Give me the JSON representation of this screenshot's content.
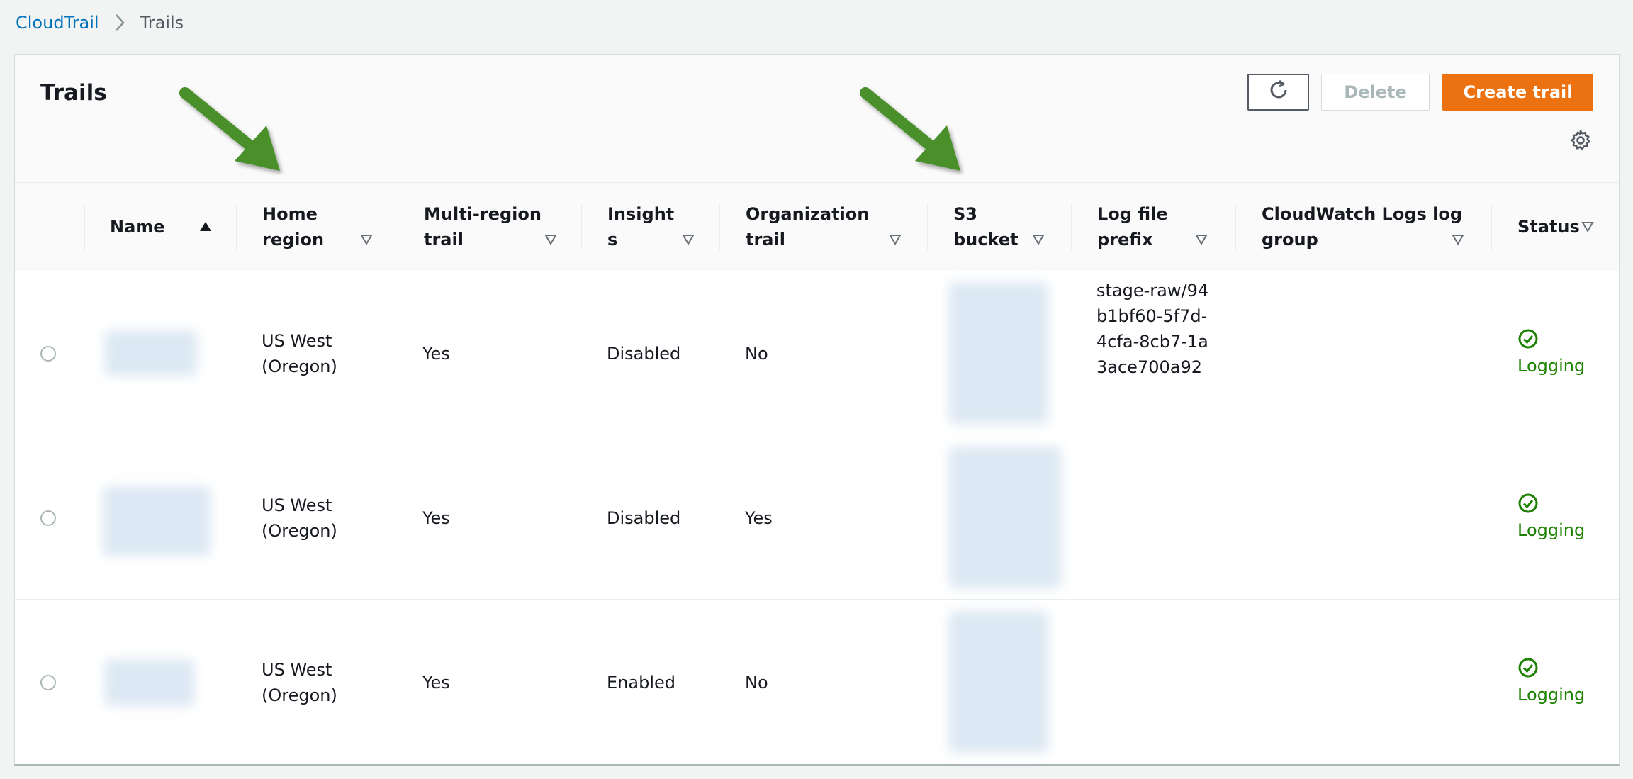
{
  "breadcrumb": {
    "root": "CloudTrail",
    "current": "Trails"
  },
  "header": {
    "title": "Trails",
    "refresh_icon": "refresh-icon",
    "delete_label": "Delete",
    "create_label": "Create trail",
    "settings_icon": "gear-icon"
  },
  "table": {
    "columns": [
      {
        "label": "Name",
        "sort": "ascending"
      },
      {
        "label": "Home\nregion",
        "sort": "none"
      },
      {
        "label": "Multi-region\ntrail",
        "sort": "none"
      },
      {
        "label": "Insight\ns",
        "sort": "none"
      },
      {
        "label": "Organization\ntrail",
        "sort": "none"
      },
      {
        "label": "S3\nbucket",
        "sort": "none"
      },
      {
        "label": "Log file\nprefix",
        "sort": "none"
      },
      {
        "label": "CloudWatch Logs log\ngroup",
        "sort": "none"
      },
      {
        "label": "Status",
        "sort": "none"
      }
    ],
    "rows": [
      {
        "home_region": "US West\n(Oregon)",
        "multi_region": "Yes",
        "insights": "Disabled",
        "organization": "No",
        "log_file_prefix": "stage-raw/94b1bf60-5f7d-4cfa-8cb7-1a3ace700a92",
        "cloudwatch_group": "",
        "status": "Logging"
      },
      {
        "home_region": "US West\n(Oregon)",
        "multi_region": "Yes",
        "insights": "Disabled",
        "organization": "Yes",
        "log_file_prefix": "",
        "cloudwatch_group": "",
        "status": "Logging"
      },
      {
        "home_region": "US West\n(Oregon)",
        "multi_region": "Yes",
        "insights": "Enabled",
        "organization": "No",
        "log_file_prefix": "",
        "cloudwatch_group": "",
        "status": "Logging"
      }
    ]
  },
  "colors": {
    "link": "#0073bb",
    "primary_button": "#ec7211",
    "status_ok": "#1d8102",
    "annotation_arrow": "#4a8f2a"
  }
}
